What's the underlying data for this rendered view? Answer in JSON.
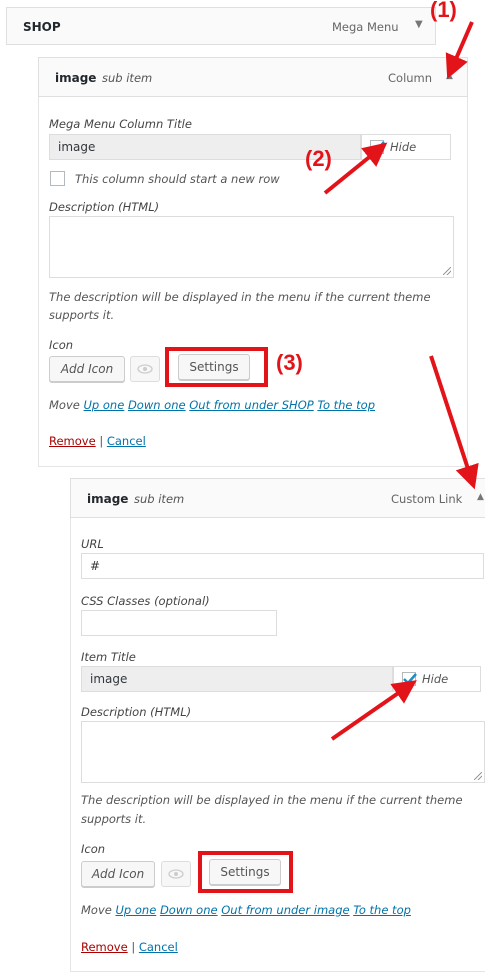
{
  "top": {
    "title": "SHOP",
    "type_label": "Mega Menu"
  },
  "item1": {
    "title": "image",
    "subtitle": "sub item",
    "type_label": "Column",
    "column_title_label": "Mega Menu Column Title",
    "column_title_value": "image",
    "hide_label": "Hide",
    "new_row_label": "This column should start a new row",
    "description_label": "Description (HTML)",
    "help_line1": "The description will be displayed in the menu if the current theme",
    "help_line2": "supports it.",
    "icon_label": "Icon",
    "add_icon": "Add Icon",
    "settings": "Settings",
    "move_label": "Move",
    "move_links": [
      "Up one",
      "Down one",
      "Out from under SHOP",
      "To the top"
    ],
    "remove": "Remove",
    "sep": "|",
    "cancel": "Cancel"
  },
  "item2": {
    "title": "image",
    "subtitle": "sub item",
    "type_label": "Custom Link",
    "url_label": "URL",
    "url_value": "#",
    "css_label": "CSS Classes (optional)",
    "item_title_label": "Item Title",
    "item_title_value": "image",
    "hide_label": "Hide",
    "description_label": "Description (HTML)",
    "help_line1": "The description will be displayed in the menu if the current theme",
    "help_line2": "supports it.",
    "icon_label": "Icon",
    "add_icon": "Add Icon",
    "settings": "Settings",
    "move_label": "Move",
    "move_links": [
      "Up one",
      "Down one",
      "Out from under image",
      "To the top"
    ],
    "remove": "Remove",
    "sep": "|",
    "cancel": "Cancel"
  },
  "callouts": {
    "one": "(1)",
    "two": "(2)",
    "three": "(3)"
  },
  "colors": {
    "annotation": "#e2141a",
    "link": "#0073aa",
    "remove": "#aa0000",
    "check": "#1e8cbe"
  }
}
